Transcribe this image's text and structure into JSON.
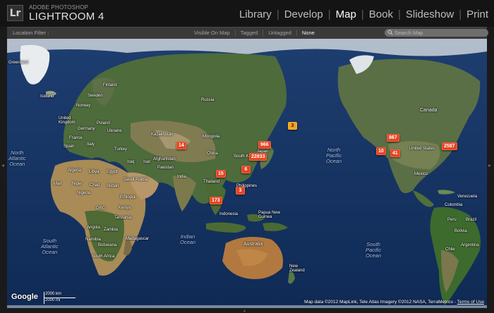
{
  "header": {
    "logo_text": "Lr",
    "brand_small": "ADOBE PHOTOSHOP",
    "brand_big": "LIGHTROOM 4",
    "modules": [
      "Library",
      "Develop",
      "Map",
      "Book",
      "Slideshow",
      "Print"
    ],
    "active_module": "Map"
  },
  "filter_bar": {
    "label": "Location Filter :",
    "options": [
      "Visible On Map",
      "Tagged",
      "Untagged",
      "None"
    ],
    "active_option": "None",
    "search_placeholder": "Search Map"
  },
  "map": {
    "oceans": {
      "north_atlantic": [
        "North",
        "Atlantic",
        "Ocean"
      ],
      "south_atlantic": [
        "South",
        "Atlantic",
        "Ocean"
      ],
      "indian": [
        "Indian",
        "Ocean"
      ],
      "north_pacific": [
        "North",
        "Pacific",
        "Ocean"
      ],
      "south_pacific": [
        "South",
        "Pacific",
        "Ocean"
      ]
    },
    "labels": {
      "greenland": "Greenland",
      "iceland": "Iceland",
      "norway": "Norway",
      "finland": "Finland",
      "sweden": "Sweden",
      "united_kingdom": "United Kingdom",
      "germany": "Germany",
      "france": "France",
      "ukraine": "Ukraine",
      "poland": "Poland",
      "spain": "Spain",
      "italy": "Italy",
      "turkey": "Turkey",
      "russia": "Russia",
      "kazakhstan": "Kazakhstan",
      "mongolia": "Mongolia",
      "china": "China",
      "afghanistan": "Afghanistan",
      "iran": "Iran",
      "iraq": "Iraq",
      "pakistan": "Pakistan",
      "india": "India",
      "saudi_arabia": "Saudi Arabia",
      "egypt": "Egypt",
      "libya": "Libya",
      "algeria": "Algeria",
      "mali": "Mali",
      "niger": "Niger",
      "chad": "Chad",
      "sudan": "Sudan",
      "nigeria": "Nigeria",
      "ethiopia": "Ethiopia",
      "kenya": "Kenya",
      "drc": "DRC",
      "tanzania": "Tanzania",
      "angola": "Angola",
      "zambia": "Zambia",
      "namibia": "Namibia",
      "botswana": "Botswana",
      "south_africa": "South Africa",
      "madagascar": "Madagascar",
      "thailand": "Thailand",
      "south_korea": "South Ko",
      "japan": "Japan",
      "philippines": "Philippines",
      "indonesia": "Indonesia",
      "papua_new_guinea": "Papua New Guinea",
      "australia": "Australia",
      "new_zealand": "New Zealand",
      "canada": "Canada",
      "united_states": "United States",
      "mexico": "Mexico",
      "venezuela": "Venezuela",
      "colombia": "Colombia",
      "peru": "Peru",
      "brazil": "Brazil",
      "bolivia": "Bolivia",
      "chile": "Chile",
      "argentina": "Argentina"
    },
    "pins": [
      {
        "count": "14",
        "color": "red"
      },
      {
        "count": "966",
        "color": "red"
      },
      {
        "count": "22833",
        "color": "red"
      },
      {
        "count": "3",
        "color": "orange"
      },
      {
        "count": "6",
        "color": "red"
      },
      {
        "count": "15",
        "color": "red"
      },
      {
        "count": "3",
        "color": "red"
      },
      {
        "count": "173",
        "color": "red"
      },
      {
        "count": "867",
        "color": "red"
      },
      {
        "count": "10",
        "color": "red"
      },
      {
        "count": "41",
        "color": "red"
      },
      {
        "count": "2587",
        "color": "red"
      }
    ],
    "google_logo": "Google",
    "scale_km": "2000 km",
    "scale_mi": "2000 mi",
    "attribution": "Map data ©2012 MapLink, Tele Atlas Imagery ©2012 NASA, TerraMetrics - ",
    "terms_link": "Terms of Use"
  },
  "colors": {
    "pin_red": "#e8431f",
    "pin_orange": "#f2a31c",
    "ocean": "#14325f",
    "land": "#4d6a3a",
    "desert": "#b0925d"
  }
}
